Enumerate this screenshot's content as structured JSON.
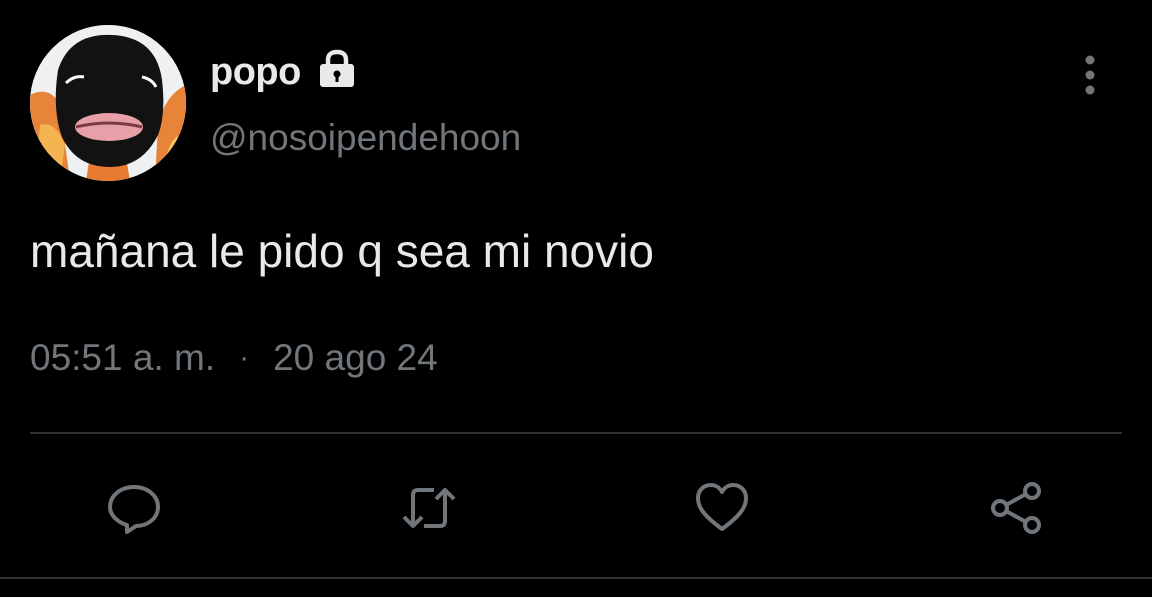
{
  "author": {
    "display_name": "popo",
    "handle": "@nosoipendehoon",
    "protected_icon": "lock-icon",
    "avatar_icon": "masked-face-avatar"
  },
  "tweet": {
    "text": "mañana le pido q sea mi novio",
    "time": "05:51 a. m.",
    "separator": "·",
    "date": "20 ago 24"
  },
  "actions": [
    {
      "name": "reply",
      "icon": "reply-icon"
    },
    {
      "name": "retweet",
      "icon": "retweet-icon"
    },
    {
      "name": "like",
      "icon": "heart-icon"
    },
    {
      "name": "share",
      "icon": "share-icon"
    }
  ],
  "colors": {
    "background": "#000000",
    "primary_text": "#e7e9ea",
    "secondary_text": "#71767b",
    "divider": "#2f3336"
  }
}
